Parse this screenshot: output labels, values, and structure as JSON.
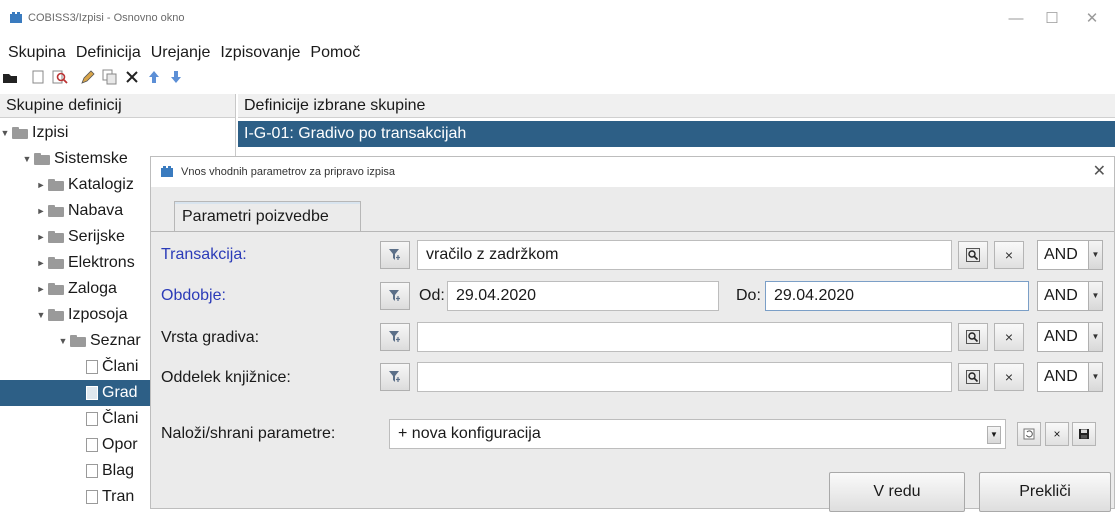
{
  "window": {
    "title": "COBISS3/Izpisi - Osnovno okno",
    "minimize": "—",
    "maximize": "☐",
    "close": "✕"
  },
  "menu": [
    "Skupina",
    "Definicija",
    "Urejanje",
    "Izpisovanje",
    "Pomoč"
  ],
  "toolbar": {
    "icons": [
      "open-icon",
      "new-icon",
      "find-icon",
      "edit-icon",
      "copy-icon",
      "delete-icon",
      "move-up-icon",
      "move-down-icon"
    ]
  },
  "left_panel": {
    "header": "Skupine definicij",
    "tree": [
      {
        "label": "Izpisi",
        "type": "folder",
        "expanded": true
      },
      {
        "label": "Sistemske",
        "type": "folder",
        "expanded": true
      },
      {
        "label": "Katalogiz",
        "type": "folder",
        "expanded": false
      },
      {
        "label": "Nabava",
        "type": "folder",
        "expanded": false
      },
      {
        "label": "Serijske",
        "type": "folder",
        "expanded": false
      },
      {
        "label": "Elektrons",
        "type": "folder",
        "expanded": false
      },
      {
        "label": "Zaloga",
        "type": "folder",
        "expanded": false
      },
      {
        "label": "Izposoja",
        "type": "folder",
        "expanded": true
      },
      {
        "label": "Seznar",
        "type": "folder",
        "expanded": true
      },
      {
        "label": "Člani",
        "type": "doc"
      },
      {
        "label": "Grad",
        "type": "doc",
        "selected": true
      },
      {
        "label": "Člani",
        "type": "doc"
      },
      {
        "label": "Opor",
        "type": "doc"
      },
      {
        "label": "Blag",
        "type": "doc"
      },
      {
        "label": "Tran",
        "type": "doc"
      }
    ]
  },
  "right_panel": {
    "header": "Definicije izbrane skupine",
    "selected_definition": "I-G-01: Gradivo po transakcijah"
  },
  "dialog": {
    "title": "Vnos vhodnih parametrov za pripravo izpisa",
    "close": "✕",
    "tab": "Parametri poizvedbe",
    "rows": {
      "transakcija": {
        "label": "Transakcija:",
        "value": "vračilo z zadržkom",
        "operator": "AND"
      },
      "obdobje": {
        "label": "Obdobje:",
        "from_label": "Od:",
        "from_value": "29.04.2020",
        "to_label": "Do:",
        "to_value": "29.04.2020",
        "operator": "AND"
      },
      "vrsta_gradiva": {
        "label": "Vrsta gradiva:",
        "value": "",
        "operator": "AND"
      },
      "oddelek": {
        "label": "Oddelek knjižnice:",
        "value": "",
        "operator": "AND"
      }
    },
    "config": {
      "label": "Naloži/shrani parametre:",
      "value": "+ nova konfiguracija"
    },
    "ok_button": "V redu",
    "cancel_button": "Prekliči",
    "clear_symbol": "×",
    "colors": {
      "required_label": "#2b3bb8",
      "selection": "#2d5f86"
    }
  }
}
